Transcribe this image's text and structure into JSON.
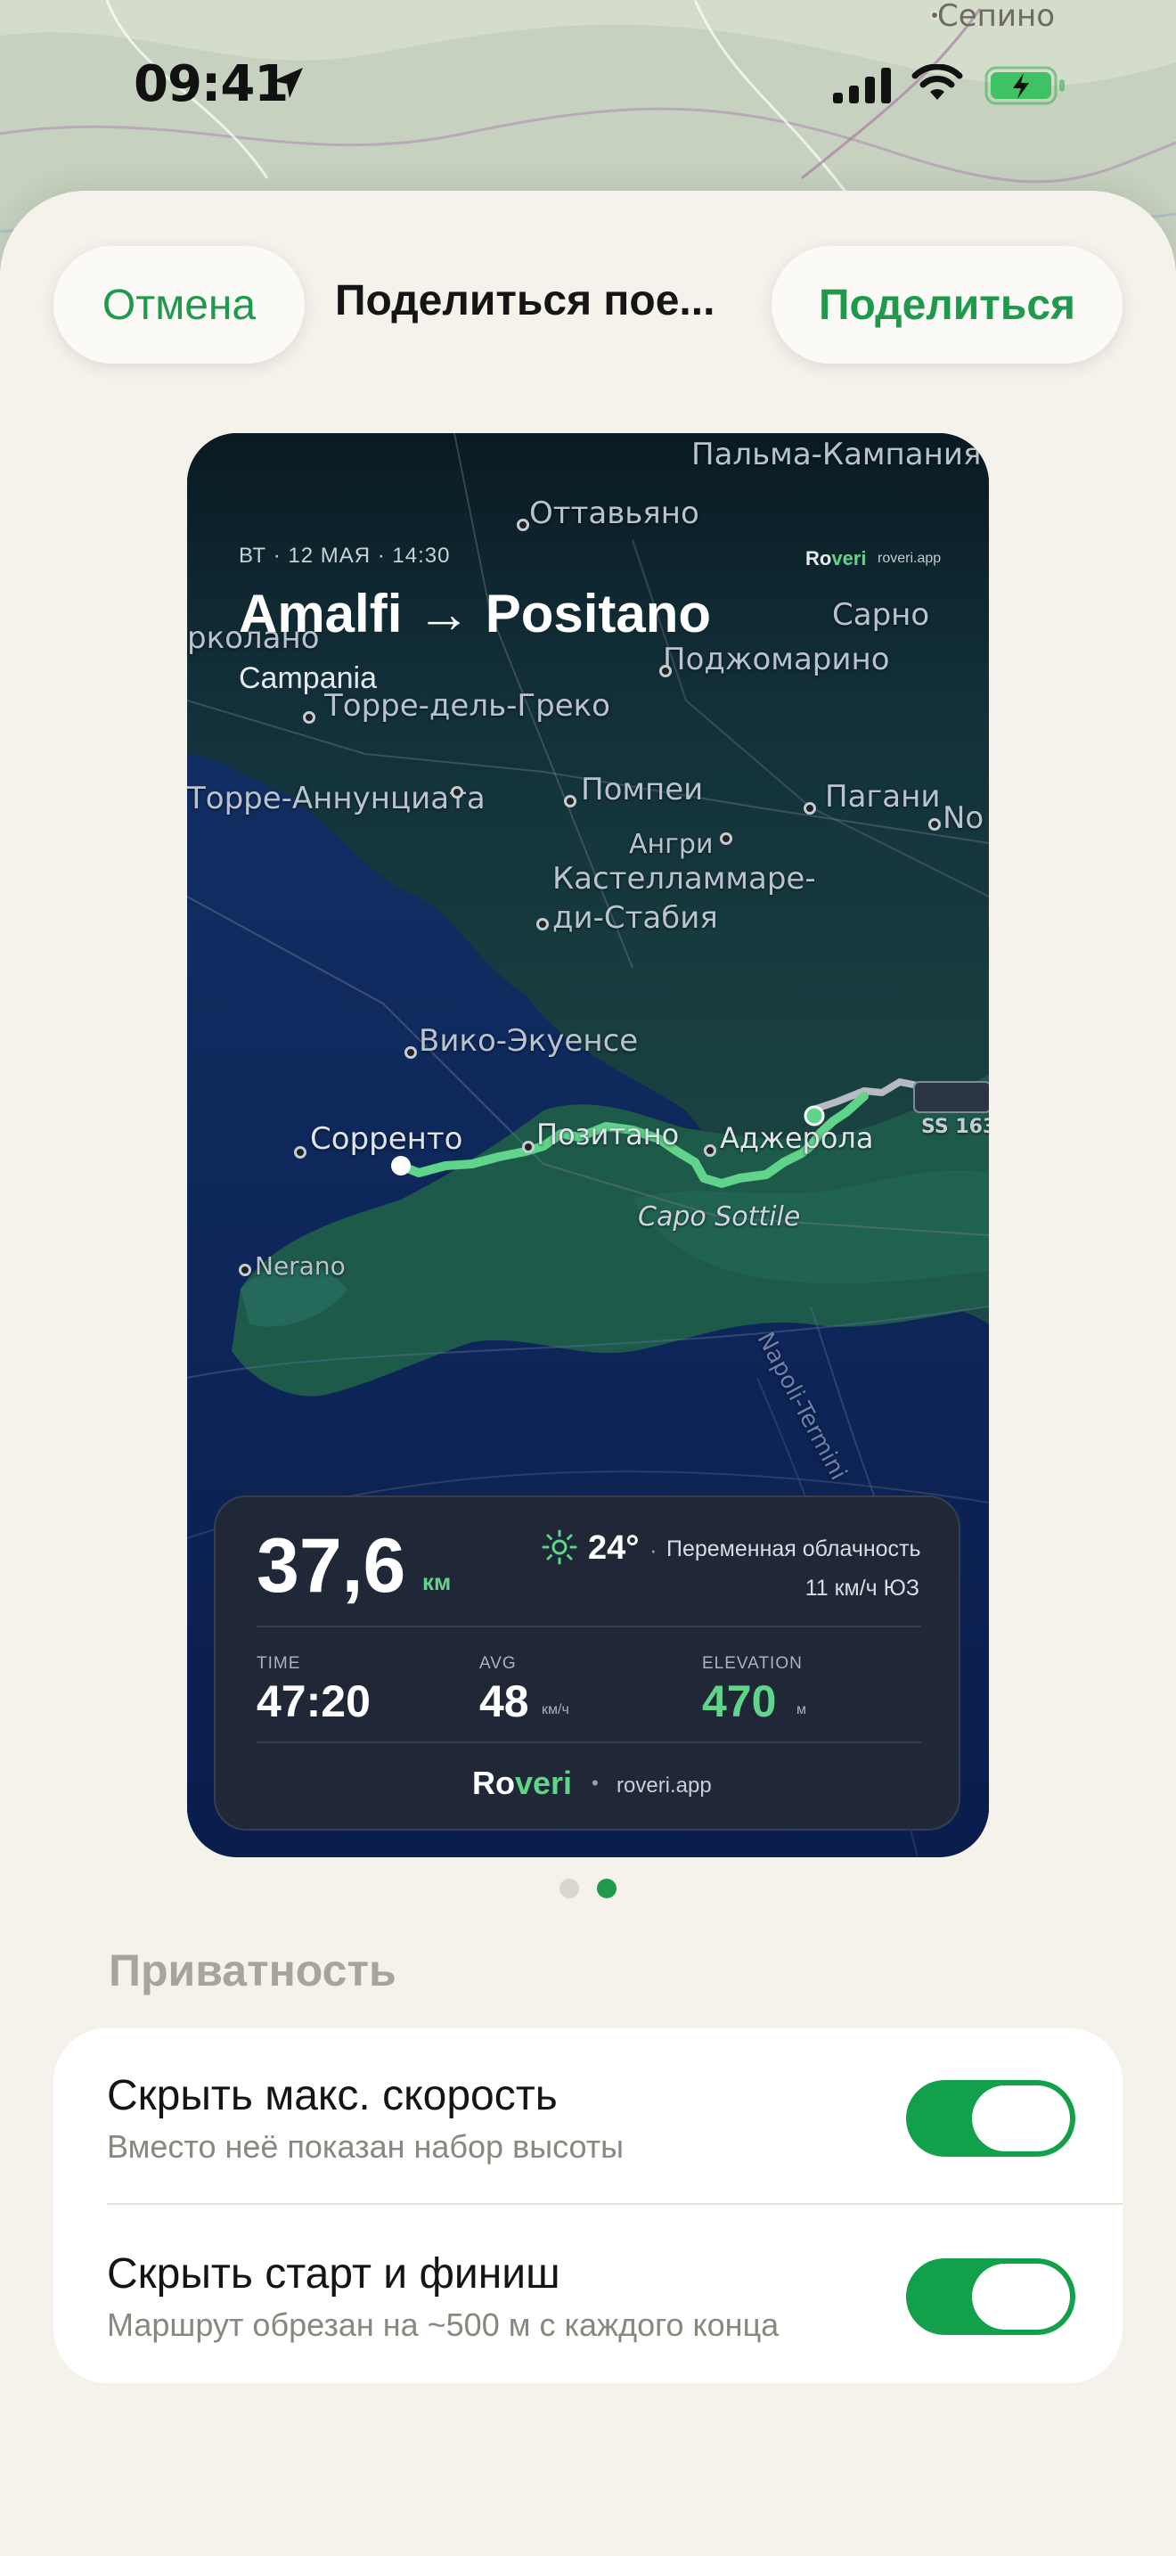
{
  "status_bar": {
    "time": "09:41",
    "icons": [
      "location-arrow-icon",
      "cellular-signal-icon",
      "wifi-icon",
      "battery-charging-icon"
    ]
  },
  "background_map": {
    "place_label": "Сепино"
  },
  "header": {
    "cancel_label": "Отмена",
    "title": "Поделиться пое...",
    "share_label": "Поделиться"
  },
  "card": {
    "date": "ВТ · 12 МАЯ · 14:30",
    "brand": {
      "prefix": "Ro",
      "accent": "veri",
      "url": "roveri.app"
    },
    "title": "Amalfi → Positano",
    "region": "Campania",
    "map_labels": {
      "palma": "Пальма-Кампания",
      "ottaviano": "Оттавьяно",
      "sarno": "Сарно",
      "ercolano": "рколано",
      "poggiomarino": "Поджомарино",
      "torre_greco": "Торре-дель-Греко",
      "torre_annunziata": "Торре-Аннунциата",
      "pompei": "Помпеи",
      "pagani": "Пагани",
      "no": "No",
      "angri": "Ангри",
      "castellammare": "Кастелламмаре-\nди-Стабия",
      "vico": "Вико-Экуенсе",
      "sorrento": "Сорренто",
      "positano": "Позитано",
      "agerola": "Аджерола",
      "capo_sottile": "Capo Sottile",
      "nerano": "Nerano",
      "road_badge": "SS 163",
      "rail": "Napoli-Termini"
    },
    "stats": {
      "distance": "37,6",
      "distance_unit": "км",
      "weather_icon": "sun-icon",
      "temperature": "24°",
      "separator": "·",
      "conditions": "Переменная облачность",
      "wind": "11 км/ч ЮЗ",
      "time_label": "TIME",
      "time_value": "47:20",
      "avg_label": "AVG",
      "avg_value": "48",
      "avg_unit": "км/ч",
      "elevation_label": "ELEVATION",
      "elevation_value": "470",
      "elevation_unit": "м"
    },
    "footer": {
      "prefix": "Ro",
      "accent": "veri",
      "dot": "•",
      "url": "roveri.app"
    }
  },
  "pager": {
    "count": 2,
    "active_index": 1
  },
  "privacy": {
    "header": "Приватность",
    "rows": [
      {
        "title": "Скрыть макс. скорость",
        "subtitle": "Вместо неё показан набор высоты",
        "enabled": true
      },
      {
        "title": "Скрыть старт и финиш",
        "subtitle": "Маршрут обрезан на ~500 м с каждого конца",
        "enabled": true
      }
    ]
  },
  "colors": {
    "accent_green": "#1f9a4d",
    "toggle_on": "#13a04b",
    "route_green": "#5fd48a",
    "sheet_bg": "#f5f2eb"
  }
}
